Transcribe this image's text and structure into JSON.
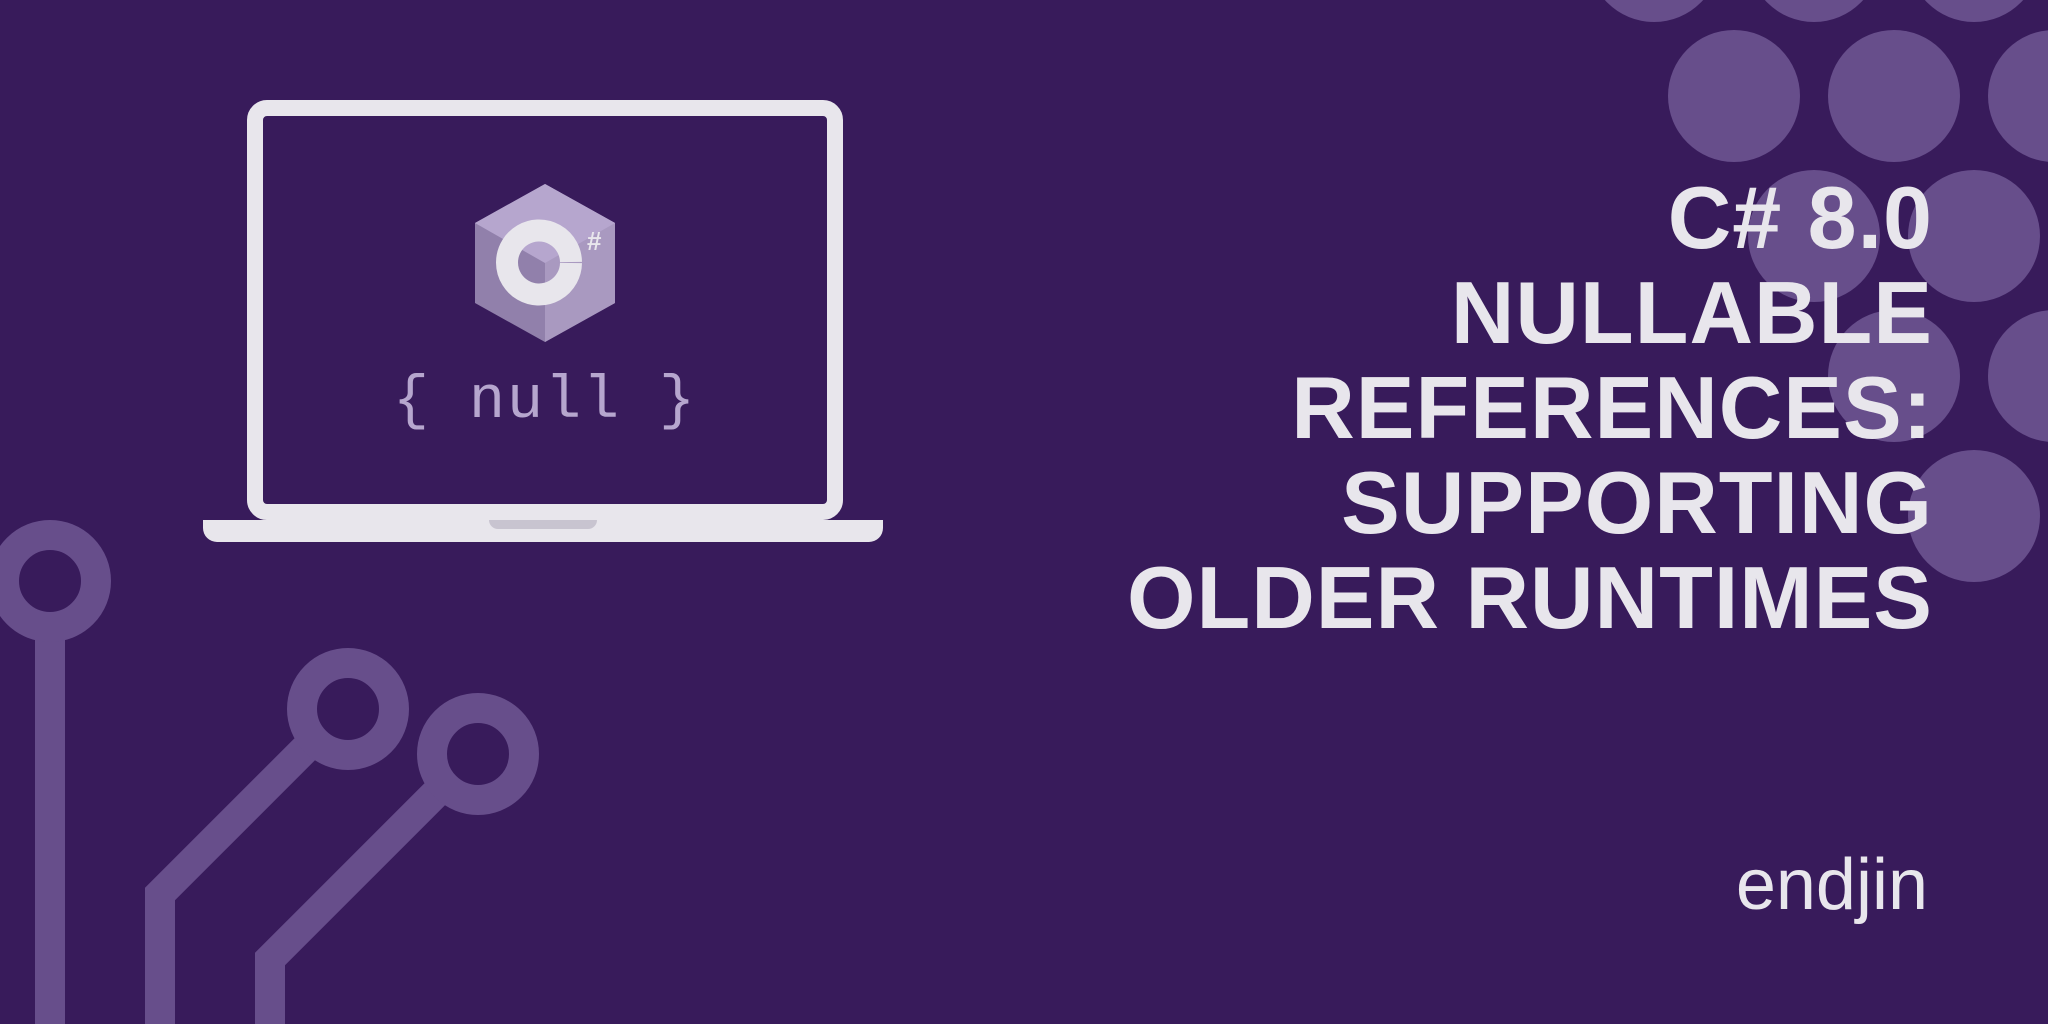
{
  "laptop": {
    "null_text": "{ null }",
    "csharp_symbol": "C",
    "csharp_hash": "#"
  },
  "title": {
    "line1": "C# 8.0",
    "line2": "NULLABLE",
    "line3": "REFERENCES:",
    "line4": "SUPPORTING",
    "line5": "OLDER RUNTIMES"
  },
  "brand": "endjin",
  "colors": {
    "background": "#381b5b",
    "accent": "#674e8b",
    "light": "#e8e6ec",
    "muted": "#b6a6ce"
  }
}
